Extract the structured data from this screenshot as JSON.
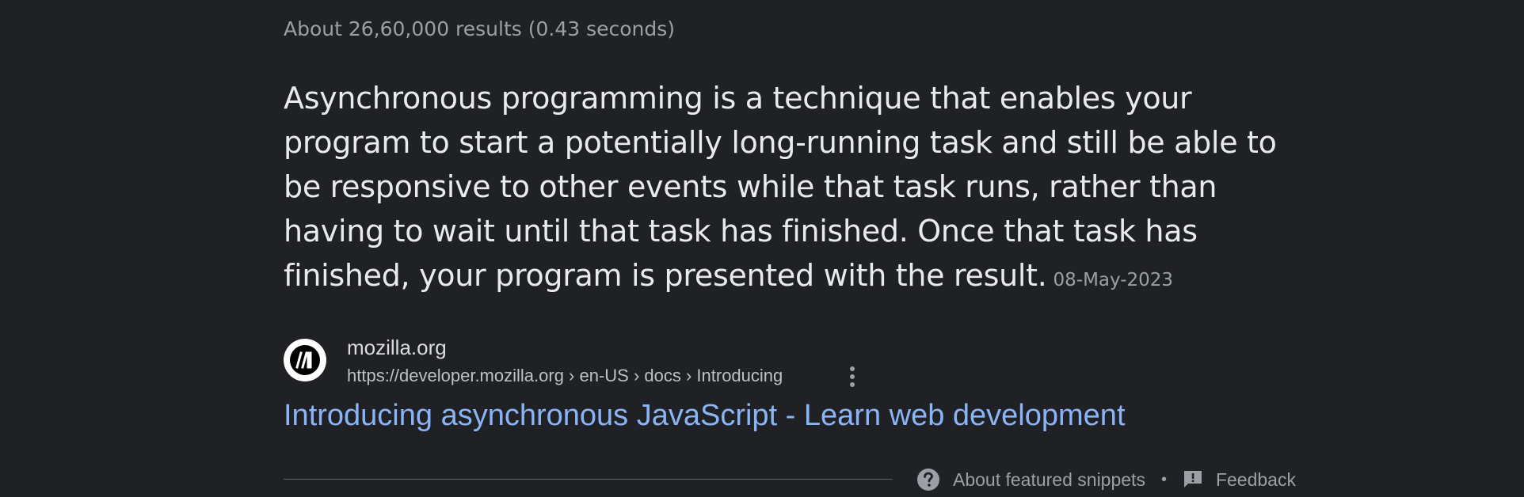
{
  "results_info": {
    "stats": "About 26,60,000 results (0.43 seconds)"
  },
  "featured_snippet": {
    "text": "Asynchronous programming is a technique that enables your program to start a potentially long-running task and still be able to be responsive to other events while that task runs, rather than having to wait until that task has finished. Once that task has finished, your program is presented with the result.",
    "date": "08-May-2023"
  },
  "source": {
    "favicon_icon": "mdn-logo-icon",
    "site_name": "mozilla.org",
    "url_breadcrumb": "https://developer.mozilla.org › en-US › docs › Introducing",
    "more_icon": "vertical-dots-icon"
  },
  "result": {
    "title": "Introducing asynchronous JavaScript - Learn web development"
  },
  "footer": {
    "about_snippets_label": "About featured snippets",
    "about_icon": "help-circle-icon",
    "separator": "•",
    "feedback_label": "Feedback",
    "feedback_icon": "feedback-icon"
  },
  "colors": {
    "background": "#202124",
    "link": "#8ab4f8",
    "text_primary": "#e8eaed",
    "text_secondary": "#9aa0a6"
  }
}
